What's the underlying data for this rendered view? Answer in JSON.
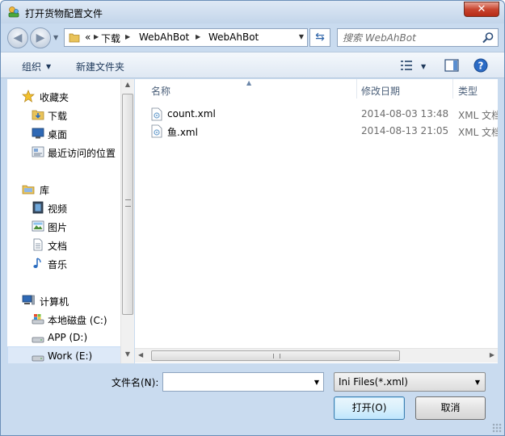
{
  "window": {
    "title": "打开货物配置文件",
    "close_glyph": "✕"
  },
  "address": {
    "overflow": "«",
    "segments": [
      "下载",
      "WebAhBot",
      "WebAhBot"
    ]
  },
  "search": {
    "placeholder": "搜索 WebAhBot"
  },
  "toolbar": {
    "organize": "组织",
    "new_folder": "新建文件夹"
  },
  "nav": {
    "favorites": {
      "label": "收藏夹",
      "items": [
        "下载",
        "桌面",
        "最近访问的位置"
      ]
    },
    "libraries": {
      "label": "库",
      "items": [
        "视频",
        "图片",
        "文档",
        "音乐"
      ]
    },
    "computer": {
      "label": "计算机",
      "items": [
        "本地磁盘 (C:)",
        "APP (D:)",
        "Work (E:)"
      ]
    }
  },
  "columns": {
    "name": "名称",
    "date": "修改日期",
    "type": "类型"
  },
  "files": [
    {
      "name": "count.xml",
      "date": "2014-08-03 13:48",
      "type": "XML 文档"
    },
    {
      "name": "鱼.xml",
      "date": "2014-08-13 21:05",
      "type": "XML 文档"
    }
  ],
  "bottom": {
    "filename_label": "文件名(N):",
    "filename_value": "",
    "filetype": "Ini Files(*.xml)",
    "open": "打开(O)",
    "cancel": "取消"
  },
  "colors": {
    "accent": "#3c7fb1",
    "chrome": "#c9dbef",
    "selection": "#dde9f8"
  }
}
